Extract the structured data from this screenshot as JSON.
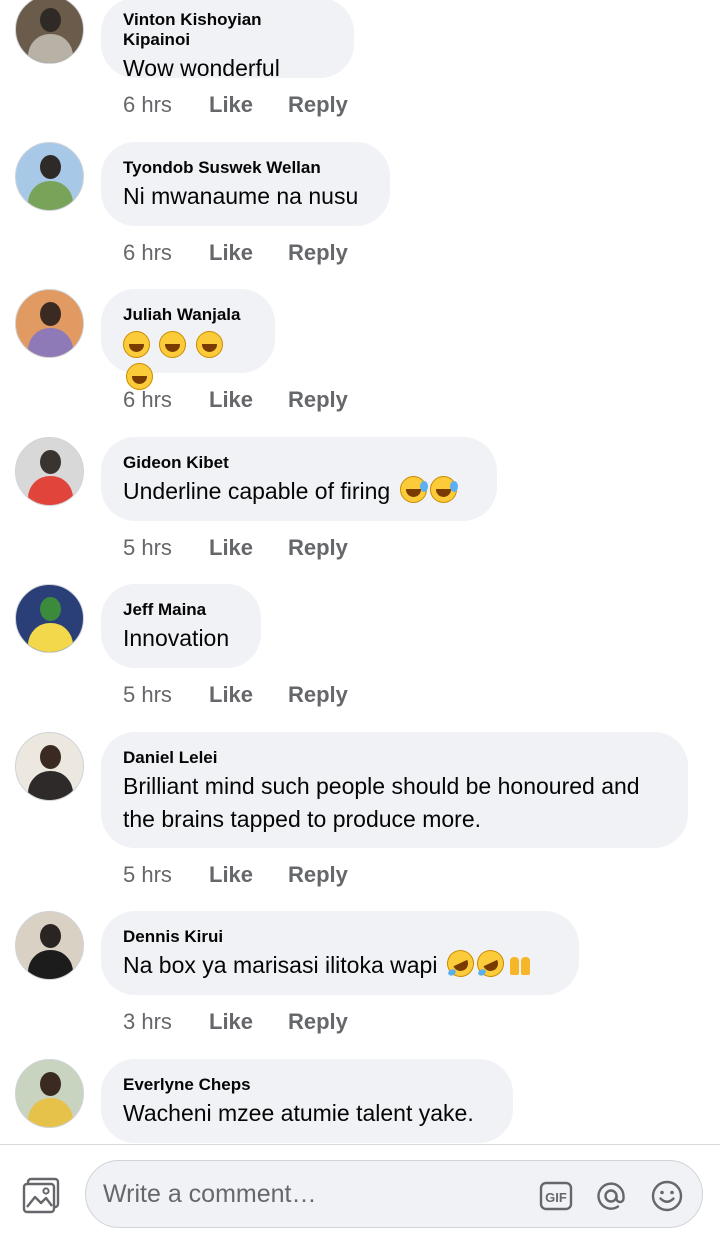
{
  "comments": [
    {
      "author": "Vinton Kishoyian Kipainoi",
      "text": "Wow wonderful",
      "emojis": [],
      "time": "6 hrs",
      "avatar_colors": [
        "#6b5b4a",
        "#2f2a26",
        "#b8b2a6"
      ]
    },
    {
      "author": "Tyondob Suswek Wellan",
      "text": "Ni mwanaume na nusu",
      "emojis": [],
      "time": "6 hrs",
      "avatar_colors": [
        "#a8c8e8",
        "#2e2a28",
        "#7aa35a"
      ]
    },
    {
      "author": "Juliah Wanjala",
      "text": "",
      "emojis": [
        "grinning-squint",
        "grinning-squint",
        "grinning-squint",
        "grinning-squint"
      ],
      "time": "6 hrs",
      "avatar_colors": [
        "#e09a62",
        "#3b2a22",
        "#8f7ab8"
      ]
    },
    {
      "author": "Gideon Kibet",
      "text": "Underline capable of firing ",
      "emojis": [
        "grinning-sweat",
        "grinning-sweat"
      ],
      "time": "5 hrs",
      "avatar_colors": [
        "#d8d8d8",
        "#3a3430",
        "#e0443a"
      ]
    },
    {
      "author": "Jeff Maina",
      "text": "Innovation",
      "emojis": [],
      "time": "5 hrs",
      "avatar_colors": [
        "#2a3f78",
        "#3c8a3c",
        "#f2d84a"
      ]
    },
    {
      "author": "Daniel Lelei",
      "text": "Brilliant mind such people should be honoured and the brains tapped to produce more.",
      "emojis": [],
      "time": "5 hrs",
      "avatar_colors": [
        "#ece7df",
        "#3a2a22",
        "#2e2a2a"
      ]
    },
    {
      "author": "Dennis Kirui",
      "text": "Na box ya marisasi ilitoka wapi ",
      "emojis": [
        "rolling-laughing",
        "rolling-laughing",
        "raising-hands"
      ],
      "time": "3 hrs",
      "avatar_colors": [
        "#d9d2c4",
        "#2a2422",
        "#1c1c1c"
      ]
    },
    {
      "author": "Everlyne Cheps",
      "text": "Wacheni mzee atumie talent yake.",
      "emojis": [],
      "time": "",
      "avatar_colors": [
        "#c8d4c0",
        "#3a2a22",
        "#e6c24a"
      ]
    }
  ],
  "actions": {
    "like": "Like",
    "reply": "Reply"
  },
  "composer": {
    "placeholder": "Write a comment…",
    "gif_label": "GIF",
    "photo_icon": "photo-icon",
    "mention_icon": "at-sign-icon",
    "emoji_icon": "smiley-icon"
  }
}
